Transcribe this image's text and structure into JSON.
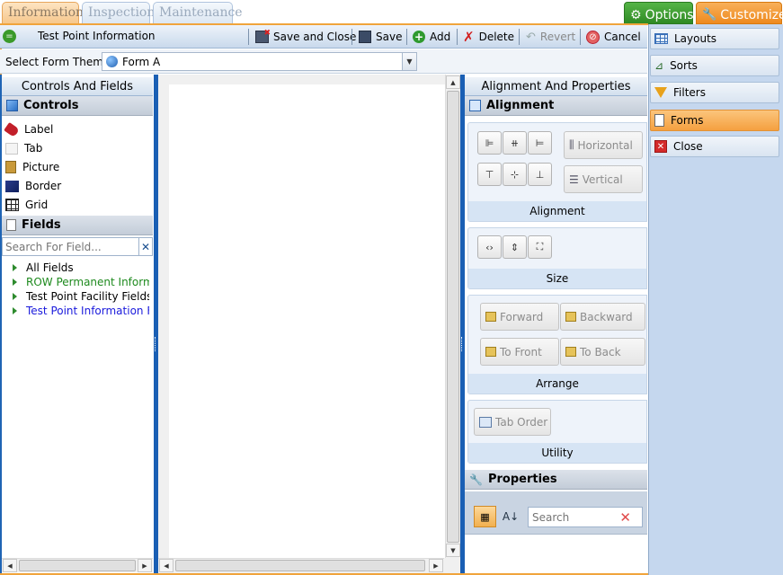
{
  "tabs": [
    {
      "label": "Information",
      "active": true
    },
    {
      "label": "Inspection",
      "active": false
    },
    {
      "label": "Maintenance",
      "active": false
    }
  ],
  "right_tabs": {
    "options": "Options",
    "customize": "Customize"
  },
  "toolbar": {
    "title": "Test Point Information",
    "save_close": "Save and Close",
    "save": "Save",
    "add": "Add",
    "delete": "Delete",
    "revert": "Revert",
    "cancel": "Cancel"
  },
  "theme": {
    "label": "Select Form Theme",
    "value": "Form A"
  },
  "left_panel": {
    "title": "Controls And Fields",
    "controls_header": "Controls",
    "controls": [
      "Label",
      "Tab",
      "Picture",
      "Border",
      "Grid"
    ],
    "fields_header": "Fields",
    "search_placeholder": "Search For Field...",
    "fields": [
      {
        "label": "All Fields",
        "color": "#000000"
      },
      {
        "label": "ROW Permanent Information Fields",
        "color": "#1e8a1e"
      },
      {
        "label": "Test Point Facility Fields",
        "color": "#000000"
      },
      {
        "label": "Test Point Information Fields",
        "color": "#1a1adc"
      }
    ]
  },
  "right_panel": {
    "title": "Alignment And Properties",
    "alignment_header": "Alignment",
    "horizontal": "Horizontal",
    "vertical": "Vertical",
    "alignment_group": "Alignment",
    "size_group": "Size",
    "forward": "Forward",
    "backward": "Backward",
    "to_front": "To Front",
    "to_back": "To Back",
    "arrange_group": "Arrange",
    "tab_order": "Tab Order",
    "utility_group": "Utility",
    "properties_header": "Properties",
    "properties_search_placeholder": "Search"
  },
  "side_menu": [
    {
      "label": "Layouts",
      "icon": "table-icon",
      "active": false
    },
    {
      "label": "Sorts",
      "icon": "sort-icon",
      "active": false
    },
    {
      "label": "Filters",
      "icon": "funnel-icon",
      "active": false
    },
    {
      "label": "Forms",
      "icon": "form-icon",
      "active": true
    },
    {
      "label": "Close",
      "icon": "close-icon",
      "active": false
    }
  ]
}
